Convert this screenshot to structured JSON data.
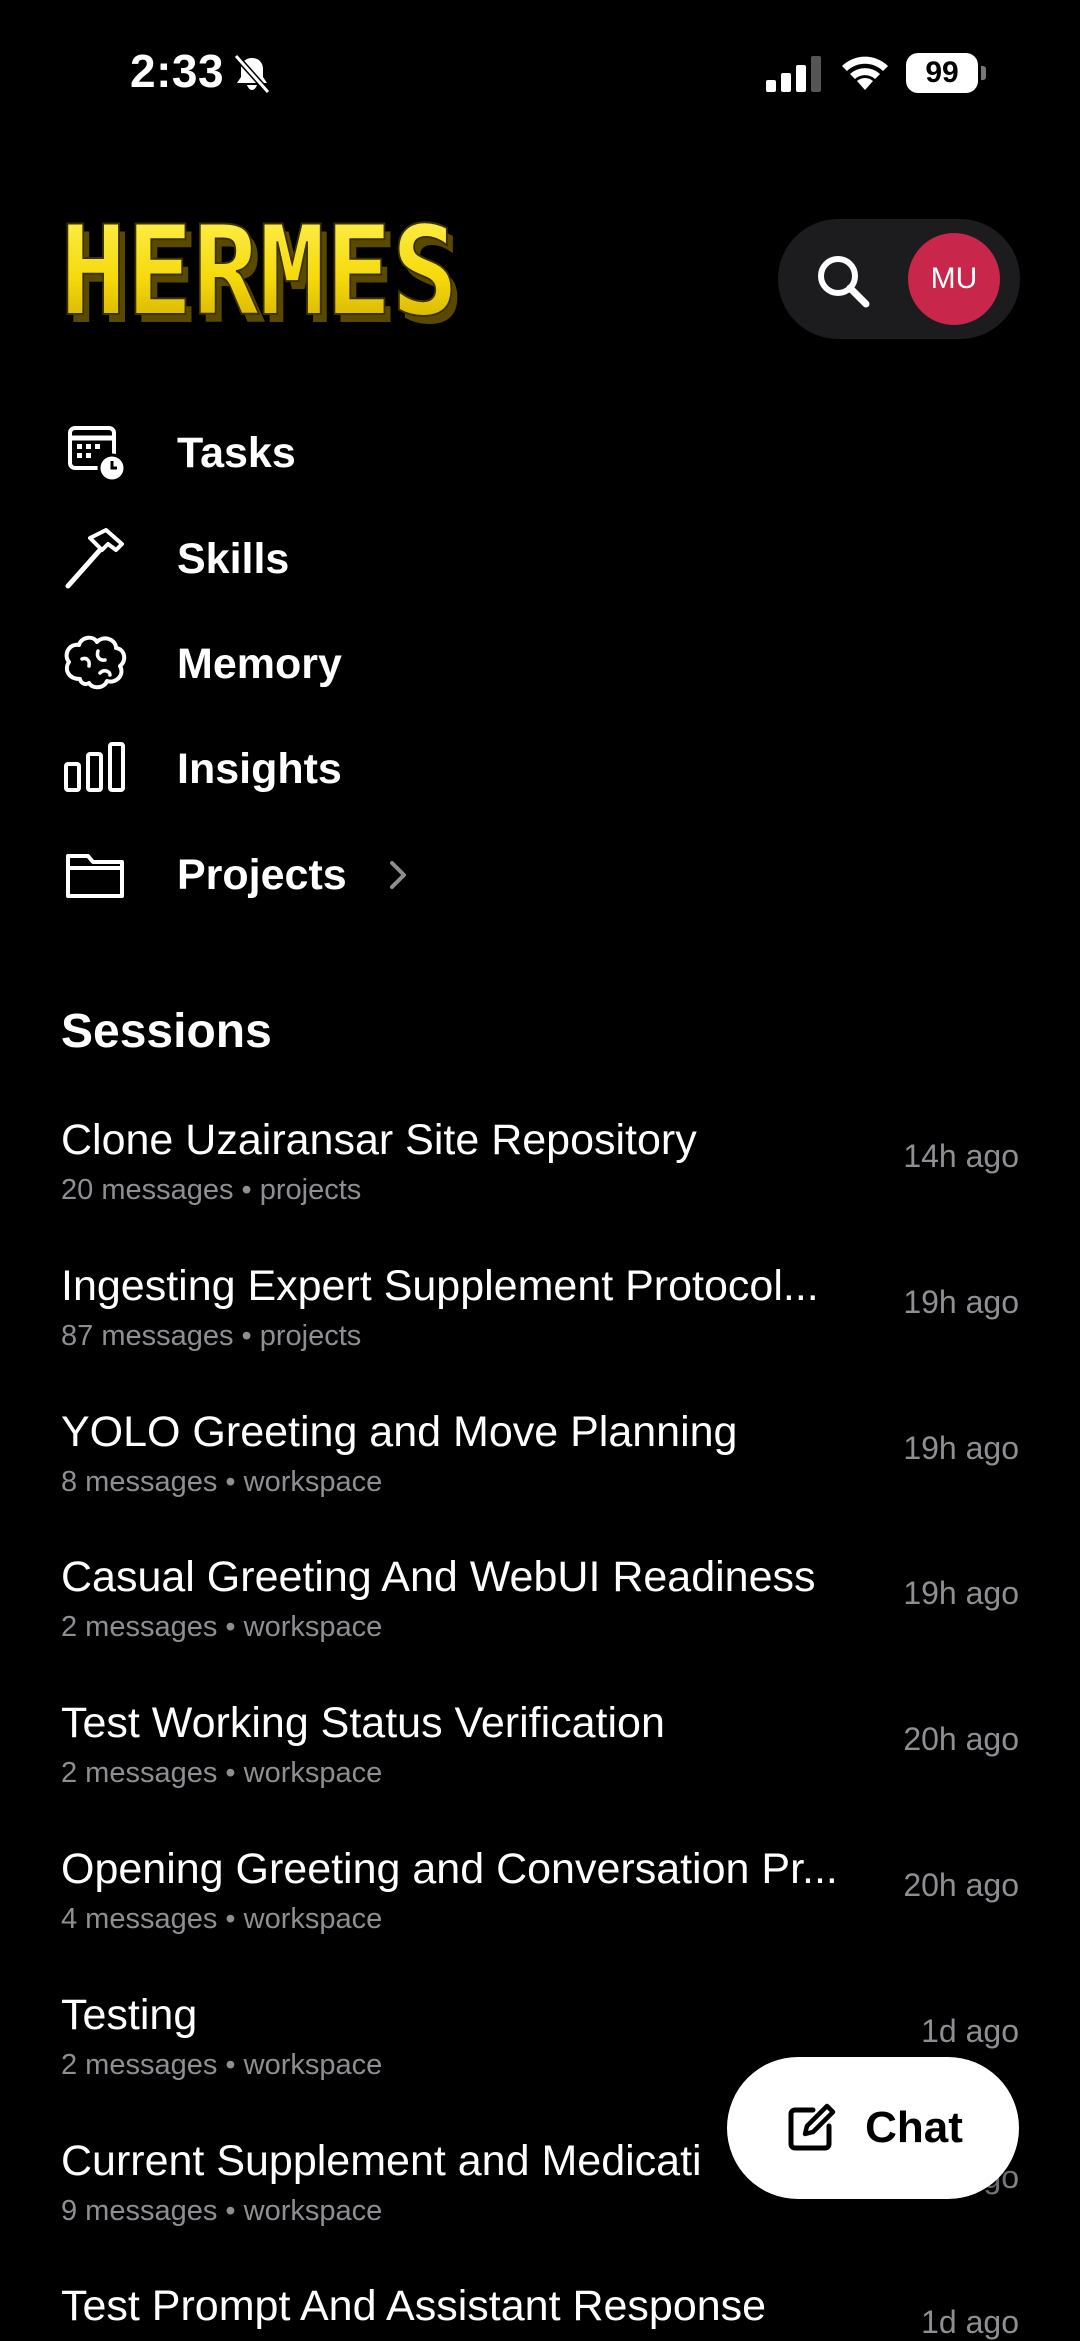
{
  "status_bar": {
    "time": "2:33",
    "battery": "99"
  },
  "header": {
    "logo_text": "HERMES",
    "avatar_initials": "MU",
    "avatar_color": "#c8264a",
    "search_icon": "search-icon"
  },
  "nav": {
    "items": [
      {
        "label": "Tasks",
        "icon": "calendar-clock-icon"
      },
      {
        "label": "Skills",
        "icon": "hammer-icon"
      },
      {
        "label": "Memory",
        "icon": "brain-icon"
      },
      {
        "label": "Insights",
        "icon": "bar-chart-icon"
      },
      {
        "label": "Projects",
        "icon": "folder-icon"
      }
    ]
  },
  "sessions": {
    "title": "Sessions",
    "items": [
      {
        "title": "Clone Uzairansar Site Repository",
        "meta": "20 messages • projects",
        "time": "14h ago"
      },
      {
        "title": "Ingesting Expert Supplement Protocol...",
        "meta": "87 messages • projects",
        "time": "19h ago"
      },
      {
        "title": "YOLO Greeting and Move Planning",
        "meta": "8 messages • workspace",
        "time": "19h ago"
      },
      {
        "title": "Casual Greeting And WebUI Readiness",
        "meta": "2 messages • workspace",
        "time": "19h ago"
      },
      {
        "title": "Test Working Status Verification",
        "meta": "2 messages • workspace",
        "time": "20h ago"
      },
      {
        "title": "Opening Greeting and Conversation Pr...",
        "meta": "4 messages • workspace",
        "time": "20h ago"
      },
      {
        "title": "Testing",
        "meta": "2 messages • workspace",
        "time": "1d ago"
      },
      {
        "title": "Current Supplement and Medicati",
        "meta": "9 messages • workspace",
        "time": "1d ago"
      },
      {
        "title": "Test Prompt And Assistant Response",
        "meta": "",
        "time": "1d ago"
      }
    ]
  },
  "fab": {
    "label": "Chat",
    "icon": "compose-icon"
  },
  "colors": {
    "background": "#000000",
    "logo_yellow": "#f5d90a",
    "secondary_text": "#8e8e93",
    "pill_bg": "#1c1c1e"
  }
}
